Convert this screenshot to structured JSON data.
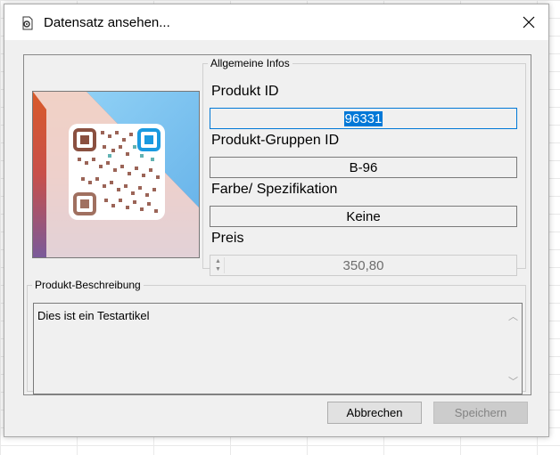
{
  "window": {
    "title": "Datensatz ansehen...",
    "close_label": "✕"
  },
  "infos": {
    "legend": "Allgemeine Infos",
    "produkt_id_label": "Produkt ID",
    "produkt_id_value": "96331",
    "gruppen_label": "Produkt-Gruppen ID",
    "gruppen_value": "B-96",
    "farbe_label": "Farbe/ Spezifikation",
    "farbe_value": "Keine",
    "preis_label": "Preis",
    "preis_value": "350,80"
  },
  "beschreibung": {
    "legend": "Produkt-Beschreibung",
    "text": "Dies ist ein Testartikel"
  },
  "buttons": {
    "cancel": "Abbrechen",
    "save": "Speichern"
  },
  "icons": {
    "title": "document-settings-icon",
    "close": "close-icon",
    "spin_up": "spin-up-icon",
    "spin_down": "spin-down-icon",
    "scroll_up": "scroll-up-icon",
    "scroll_down": "scroll-down-icon"
  }
}
